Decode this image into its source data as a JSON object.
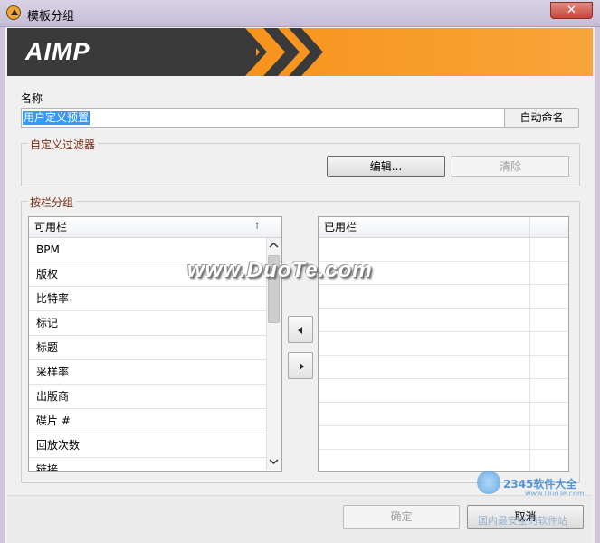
{
  "window": {
    "title": "模板分组",
    "close_glyph": "✕"
  },
  "banner": {
    "logo_text": "AIMP",
    "colors": {
      "dark": "#3a3a3a",
      "orange": "#f7941d"
    }
  },
  "name_section": {
    "label": "名称",
    "value": "用户定义预置",
    "auto_name_button": "自动命名"
  },
  "filter_section": {
    "title": "自定义过滤器",
    "edit_button": "编辑...",
    "clear_button": "清除"
  },
  "group_section": {
    "title": "按栏分组",
    "available": {
      "header": "可用栏",
      "sort_glyph": "↑",
      "items": [
        "BPM",
        "版权",
        "比特率",
        "标记",
        "标题",
        "采样率",
        "出版商",
        "碟片 #",
        "回放次数",
        "链接"
      ]
    },
    "used": {
      "header": "已用栏",
      "items": []
    }
  },
  "watermark": {
    "text": "www.DuoTe.com",
    "corner_text": "2345软件大全",
    "corner_url": "www.DuoTe.com",
    "corner_sub": "国内最安全的软件站"
  },
  "footer": {
    "ok_button": "确定",
    "cancel_button": "取消"
  }
}
